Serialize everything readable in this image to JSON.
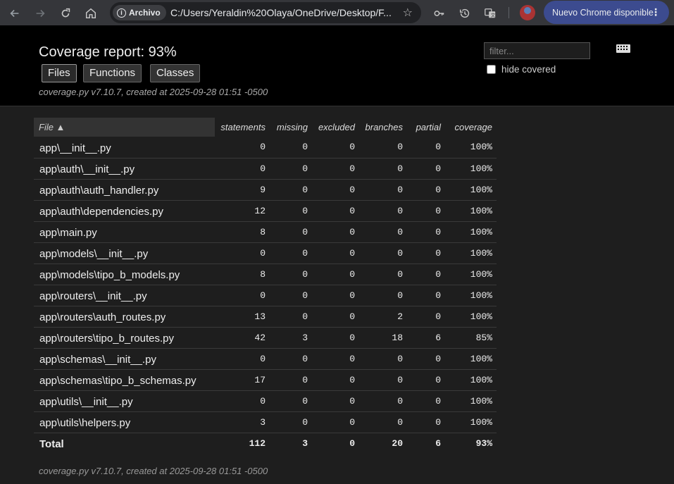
{
  "browser": {
    "site_chip": "Archivo",
    "url": "C:/Users/Yeraldin%20Olaya/OneDrive/Desktop/F...",
    "update_label": "Nuevo Chrome disponible"
  },
  "header": {
    "title": "Coverage report: 93%",
    "tabs": [
      {
        "label": "Files"
      },
      {
        "label": "Functions"
      },
      {
        "label": "Classes"
      }
    ],
    "created": "coverage.py v7.10.7, created at 2025-09-28 01:51 -0500",
    "filter_placeholder": "filter...",
    "hide_covered_label": "hide covered"
  },
  "table": {
    "columns": [
      "File ▲",
      "statements",
      "missing",
      "excluded",
      "branches",
      "partial",
      "coverage"
    ],
    "rows": [
      {
        "file": "app\\__init__.py",
        "statements": "0",
        "missing": "0",
        "excluded": "0",
        "branches": "0",
        "partial": "0",
        "coverage": "100%"
      },
      {
        "file": "app\\auth\\__init__.py",
        "statements": "0",
        "missing": "0",
        "excluded": "0",
        "branches": "0",
        "partial": "0",
        "coverage": "100%"
      },
      {
        "file": "app\\auth\\auth_handler.py",
        "statements": "9",
        "missing": "0",
        "excluded": "0",
        "branches": "0",
        "partial": "0",
        "coverage": "100%"
      },
      {
        "file": "app\\auth\\dependencies.py",
        "statements": "12",
        "missing": "0",
        "excluded": "0",
        "branches": "0",
        "partial": "0",
        "coverage": "100%"
      },
      {
        "file": "app\\main.py",
        "statements": "8",
        "missing": "0",
        "excluded": "0",
        "branches": "0",
        "partial": "0",
        "coverage": "100%"
      },
      {
        "file": "app\\models\\__init__.py",
        "statements": "0",
        "missing": "0",
        "excluded": "0",
        "branches": "0",
        "partial": "0",
        "coverage": "100%"
      },
      {
        "file": "app\\models\\tipo_b_models.py",
        "statements": "8",
        "missing": "0",
        "excluded": "0",
        "branches": "0",
        "partial": "0",
        "coverage": "100%"
      },
      {
        "file": "app\\routers\\__init__.py",
        "statements": "0",
        "missing": "0",
        "excluded": "0",
        "branches": "0",
        "partial": "0",
        "coverage": "100%"
      },
      {
        "file": "app\\routers\\auth_routes.py",
        "statements": "13",
        "missing": "0",
        "excluded": "0",
        "branches": "2",
        "partial": "0",
        "coverage": "100%"
      },
      {
        "file": "app\\routers\\tipo_b_routes.py",
        "statements": "42",
        "missing": "3",
        "excluded": "0",
        "branches": "18",
        "partial": "6",
        "coverage": "85%"
      },
      {
        "file": "app\\schemas\\__init__.py",
        "statements": "0",
        "missing": "0",
        "excluded": "0",
        "branches": "0",
        "partial": "0",
        "coverage": "100%"
      },
      {
        "file": "app\\schemas\\tipo_b_schemas.py",
        "statements": "17",
        "missing": "0",
        "excluded": "0",
        "branches": "0",
        "partial": "0",
        "coverage": "100%"
      },
      {
        "file": "app\\utils\\__init__.py",
        "statements": "0",
        "missing": "0",
        "excluded": "0",
        "branches": "0",
        "partial": "0",
        "coverage": "100%"
      },
      {
        "file": "app\\utils\\helpers.py",
        "statements": "3",
        "missing": "0",
        "excluded": "0",
        "branches": "0",
        "partial": "0",
        "coverage": "100%"
      }
    ],
    "total": {
      "file": "Total",
      "statements": "112",
      "missing": "3",
      "excluded": "0",
      "branches": "20",
      "partial": "6",
      "coverage": "93%"
    }
  },
  "footer": {
    "created": "coverage.py v7.10.7, created at 2025-09-28 01:51 -0500"
  }
}
